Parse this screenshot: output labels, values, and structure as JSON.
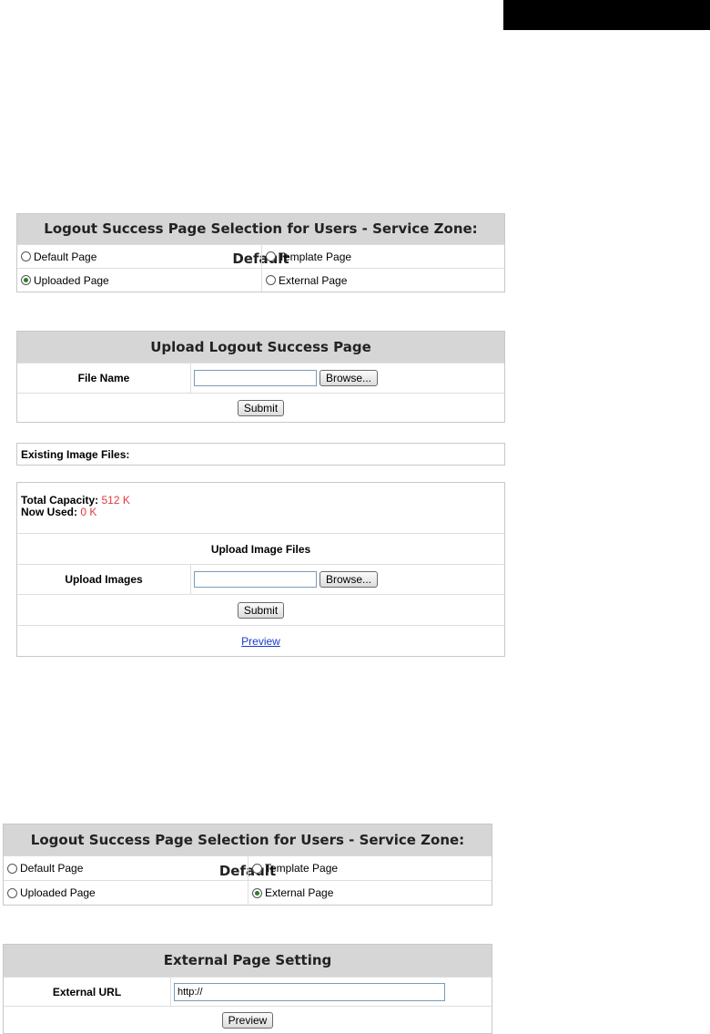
{
  "selection_panel_1": {
    "title": "Logout Success Page Selection for Users - Service Zone: Default",
    "options": [
      {
        "label": "Default Page",
        "selected": false
      },
      {
        "label": "Template Page",
        "selected": false
      },
      {
        "label": "Uploaded Page",
        "selected": true
      },
      {
        "label": "External Page",
        "selected": false
      }
    ]
  },
  "upload_panel": {
    "title": "Upload Logout Success Page",
    "file_label": "File Name",
    "file_value": "",
    "browse_label": "Browse...",
    "submit_label": "Submit"
  },
  "existing_images": {
    "label": "Existing Image Files:"
  },
  "image_panel": {
    "capacity_label": "Total Capacity:",
    "capacity_value": "512 K",
    "used_label": "Now Used:",
    "used_value": "0 K",
    "section_title": "Upload Image Files",
    "upload_label": "Upload Images",
    "upload_value": "",
    "browse_label": "Browse...",
    "submit_label": "Submit",
    "preview_link": "Preview"
  },
  "selection_panel_2": {
    "title": "Logout Success Page Selection for Users - Service Zone: Default",
    "options": [
      {
        "label": "Default Page",
        "selected": false
      },
      {
        "label": "Template Page",
        "selected": false
      },
      {
        "label": "Uploaded Page",
        "selected": false
      },
      {
        "label": "External Page",
        "selected": true
      }
    ]
  },
  "external_panel": {
    "title": "External Page Setting",
    "url_label": "External URL",
    "url_value": "http://",
    "preview_label": "Preview"
  },
  "colors": {
    "header_bg": "#d6d6d6",
    "value_red": "#e23b3b",
    "link_blue": "#1a3acc",
    "radio_selected": "#2a7d2a"
  }
}
